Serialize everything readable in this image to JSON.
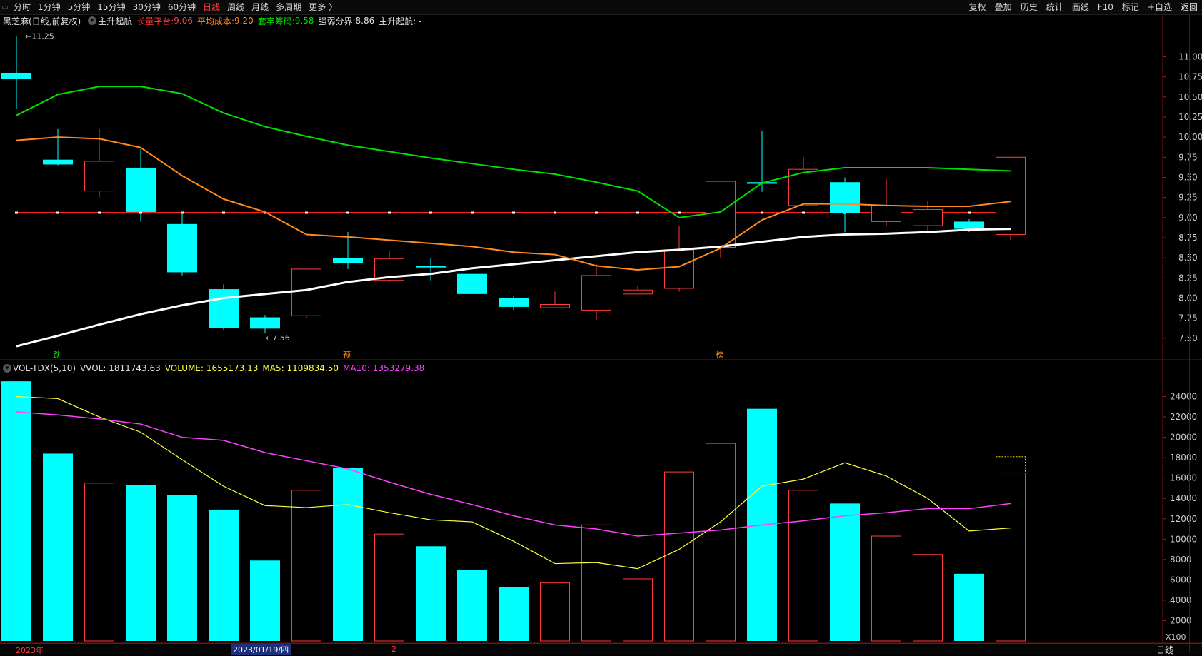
{
  "toolbar": {
    "periods": [
      "分时",
      "1分钟",
      "5分钟",
      "15分钟",
      "30分钟",
      "60分钟",
      "日线",
      "周线",
      "月线",
      "多周期",
      "更多 〉"
    ],
    "active_period": "日线",
    "tools": [
      "复权",
      "叠加",
      "历史",
      "统计",
      "画线",
      "F10",
      "标记",
      "+自选",
      "返回"
    ]
  },
  "info": {
    "name": "黑芝麻(日线,前复权)",
    "indicator": "主升起航",
    "cb_label": "长量平台:",
    "cb_value": "9.06",
    "avg_label": "平均成本:",
    "avg_value": "9.20",
    "trap_label": "套牢筹码:",
    "trap_value": "9.58",
    "split_label": "强弱分界:",
    "split_value": "8.86",
    "tail": "主升起航: -"
  },
  "vol_info": {
    "name": "VOL-TDX(5,10)",
    "vvol": "VVOL: 1811743.63",
    "volume": "VOLUME: 1655173.13",
    "ma5": "MA5: 1109834.50",
    "ma10": "MA10: 1353279.38"
  },
  "annotations": {
    "high": "11.25",
    "low": "7.56",
    "marks": [
      "跌",
      "预",
      "榜"
    ]
  },
  "status": {
    "year": "2023年",
    "date": "2023/01/19/四",
    "page": "2",
    "tab": "日线",
    "scale_tag": "X100"
  },
  "colors": {
    "up": "#ff3b3b",
    "down": "#00ffff",
    "green": "#00e000",
    "orange": "#ff8a1f",
    "white": "#ffffff",
    "yellow": "#ffff40",
    "magenta": "#ff40ff",
    "cost_line": "#ff2020"
  },
  "chart_data": [
    {
      "type": "candlestick",
      "title": "黑芝麻(日线,前复权)",
      "ylim": [
        7.25,
        11.35
      ],
      "y_ticks": [
        7.5,
        7.75,
        8.0,
        8.25,
        8.5,
        8.75,
        9.0,
        9.25,
        9.5,
        9.75,
        10.0,
        10.25,
        10.5,
        10.75,
        11.0
      ],
      "candles": [
        {
          "o": 10.8,
          "h": 11.25,
          "l": 10.35,
          "c": 10.72
        },
        {
          "o": 9.72,
          "h": 10.1,
          "l": 9.65,
          "c": 9.66
        },
        {
          "o": 9.33,
          "h": 10.1,
          "l": 9.25,
          "c": 9.7
        },
        {
          "o": 9.62,
          "h": 9.85,
          "l": 8.95,
          "c": 9.07
        },
        {
          "o": 8.92,
          "h": 9.07,
          "l": 8.28,
          "c": 8.32
        },
        {
          "o": 8.11,
          "h": 8.17,
          "l": 7.6,
          "c": 7.63
        },
        {
          "o": 7.76,
          "h": 7.79,
          "l": 7.56,
          "c": 7.62
        },
        {
          "o": 7.78,
          "h": 8.36,
          "l": 7.75,
          "c": 8.36
        },
        {
          "o": 8.5,
          "h": 8.82,
          "l": 8.36,
          "c": 8.43
        },
        {
          "o": 8.22,
          "h": 8.58,
          "l": 8.2,
          "c": 8.49
        },
        {
          "o": 8.4,
          "h": 8.5,
          "l": 8.22,
          "c": 8.38
        },
        {
          "o": 8.3,
          "h": 8.3,
          "l": 8.05,
          "c": 8.05
        },
        {
          "o": 8.0,
          "h": 8.03,
          "l": 7.85,
          "c": 7.89
        },
        {
          "o": 7.88,
          "h": 8.08,
          "l": 7.88,
          "c": 7.92
        },
        {
          "o": 7.85,
          "h": 8.42,
          "l": 7.73,
          "c": 8.28
        },
        {
          "o": 8.05,
          "h": 8.15,
          "l": 8.05,
          "c": 8.1
        },
        {
          "o": 8.12,
          "h": 8.9,
          "l": 8.08,
          "c": 8.6
        },
        {
          "o": 8.63,
          "h": 9.45,
          "l": 8.5,
          "c": 9.45
        },
        {
          "o": 9.44,
          "h": 10.08,
          "l": 9.32,
          "c": 9.42
        },
        {
          "o": 9.15,
          "h": 9.75,
          "l": 9.15,
          "c": 9.6
        },
        {
          "o": 9.44,
          "h": 9.5,
          "l": 8.82,
          "c": 9.06
        },
        {
          "o": 8.95,
          "h": 9.48,
          "l": 8.9,
          "c": 9.15
        },
        {
          "o": 8.9,
          "h": 9.2,
          "l": 8.8,
          "c": 9.1
        },
        {
          "o": 8.95,
          "h": 8.98,
          "l": 8.82,
          "c": 8.86
        },
        {
          "o": 8.79,
          "h": 9.75,
          "l": 8.72,
          "c": 9.75
        }
      ],
      "series": [
        {
          "name": "强弱分界",
          "color": "white",
          "values": [
            7.4,
            7.53,
            7.67,
            7.8,
            7.91,
            8.0,
            8.05,
            8.1,
            8.2,
            8.26,
            8.3,
            8.37,
            8.42,
            8.47,
            8.52,
            8.57,
            8.6,
            8.64,
            8.7,
            8.76,
            8.79,
            8.8,
            8.82,
            8.85,
            8.86
          ]
        },
        {
          "name": "平均成本",
          "color": "orange",
          "values": [
            9.96,
            10.0,
            9.98,
            9.87,
            9.52,
            9.23,
            9.07,
            8.79,
            8.76,
            8.72,
            8.68,
            8.64,
            8.57,
            8.54,
            8.4,
            8.35,
            8.39,
            8.62,
            8.97,
            9.17,
            9.17,
            9.15,
            9.14,
            9.14,
            9.2
          ]
        },
        {
          "name": "套牢筹码",
          "color": "green",
          "values": [
            10.27,
            10.53,
            10.63,
            10.63,
            10.54,
            10.3,
            10.13,
            10.01,
            9.9,
            9.82,
            9.74,
            9.67,
            9.6,
            9.54,
            9.44,
            9.33,
            9.0,
            9.07,
            9.43,
            9.56,
            9.62,
            9.62,
            9.62,
            9.6,
            9.58
          ]
        }
      ],
      "cost_line": {
        "name": "长量平台",
        "value": 9.06
      }
    },
    {
      "type": "bar",
      "title": "VOL-TDX(5,10)",
      "ylim": [
        0,
        26000
      ],
      "y_ticks": [
        2000,
        4000,
        6000,
        8000,
        10000,
        12000,
        14000,
        16000,
        18000,
        20000,
        22000,
        24000
      ],
      "volume": [
        25500,
        18400,
        15500,
        15300,
        14300,
        12900,
        7900,
        14800,
        17000,
        10500,
        9300,
        7000,
        5300,
        5700,
        11400,
        6100,
        16600,
        19400,
        22800,
        14800,
        13500,
        10300,
        8500,
        6600,
        16500
      ],
      "ma5": [
        24000,
        23800,
        22000,
        20500,
        17800,
        15200,
        13300,
        13100,
        13400,
        12600,
        11900,
        11700,
        9800,
        7600,
        7700,
        7100,
        9000,
        11700,
        15200,
        15900,
        17500,
        16200,
        14000,
        10800,
        11100
      ],
      "ma10": [
        22500,
        22200,
        21800,
        21300,
        20000,
        19700,
        18500,
        17700,
        16900,
        15600,
        14400,
        13400,
        12300,
        11400,
        11000,
        10300,
        10600,
        10900,
        11400,
        11800,
        12300,
        12600,
        13000,
        13000,
        13500
      ],
      "vvol_forecast": 18100
    }
  ]
}
